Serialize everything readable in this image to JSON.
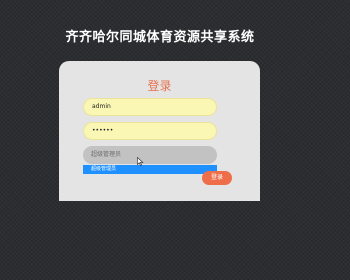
{
  "app": {
    "title": "齐齐哈尔同城体育资源共享系统"
  },
  "login": {
    "heading": "登录",
    "username": "admin",
    "password": "••••••",
    "role_placeholder": "超级管理员",
    "role_options": [
      "超级管理员"
    ],
    "submit_label": "登录"
  },
  "colors": {
    "background": "#2b2d30",
    "card": "#e4e4e4",
    "accent": "#e8734f",
    "input_fill": "#faf6b4",
    "select_fill": "#c2c2c2",
    "option_highlight": "#1e90ff",
    "button": "#ee6e4a"
  },
  "icons": {
    "cursor": "mouse-pointer-icon"
  }
}
